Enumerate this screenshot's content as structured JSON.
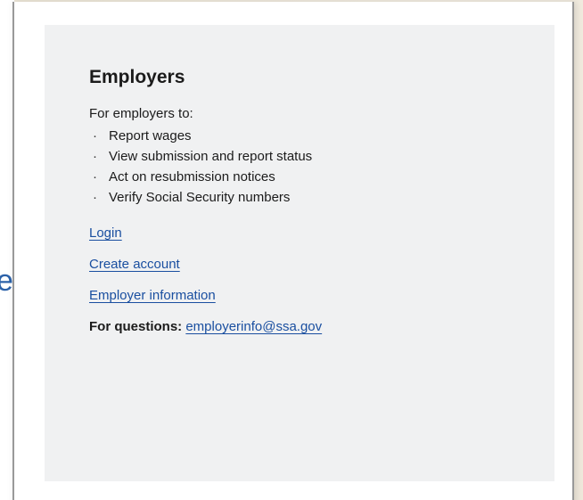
{
  "stray_text": "e",
  "card": {
    "title": "Employers",
    "intro": "For employers to:",
    "bullet_symbol": "·",
    "bullets": [
      "Report wages",
      "View submission and report status",
      "Act on resubmission notices",
      "Verify Social Security numbers"
    ],
    "links": {
      "login": "Login",
      "create_account": "Create account",
      "employer_information": "Employer information"
    },
    "questions": {
      "label": "For questions:",
      "email": "employerinfo@ssa.gov"
    }
  },
  "colors": {
    "link": "#1a4fa0",
    "card_background": "#f0f1f2",
    "text": "#1b1b1b"
  }
}
